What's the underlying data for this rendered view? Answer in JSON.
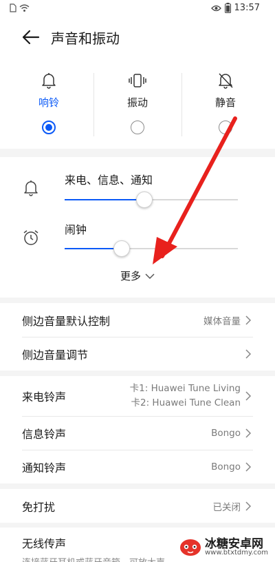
{
  "status_bar": {
    "time": "13:57"
  },
  "header": {
    "title": "声音和振动"
  },
  "modes": [
    {
      "label": "响铃",
      "icon": "bell-icon",
      "selected": true
    },
    {
      "label": "振动",
      "icon": "vibrate-icon",
      "selected": false
    },
    {
      "label": "静音",
      "icon": "bell-off-icon",
      "selected": false
    }
  ],
  "volume": {
    "sliders": [
      {
        "label": "来电、信息、通知",
        "icon": "bell-icon",
        "level": 0.46
      },
      {
        "label": "闹钟",
        "icon": "alarm-clock-icon",
        "level": 0.33
      }
    ],
    "more_label": "更多"
  },
  "groups": [
    {
      "rows": [
        {
          "title": "侧边音量默认控制",
          "value": "媒体音量"
        },
        {
          "title": "侧边音量调节",
          "value": ""
        }
      ]
    },
    {
      "rows": [
        {
          "title": "来电铃声",
          "value_line1": "卡1: Huawei Tune Living",
          "value_line2": "卡2: Huawei Tune Clean"
        },
        {
          "title": "信息铃声",
          "value": "Bongo"
        },
        {
          "title": "通知铃声",
          "value": "Bongo"
        }
      ]
    },
    {
      "rows": [
        {
          "title": "免打扰",
          "value": "已关闭"
        }
      ]
    },
    {
      "rows": [
        {
          "title": "无线传声",
          "subtitle": "连接蓝牙耳机或蓝牙音箱，可放大声"
        }
      ]
    }
  ],
  "annotation": {
    "color": "#e8211d"
  },
  "watermark": {
    "name": "冰糖安卓网",
    "url": "www.btxtdmy.com"
  },
  "colors": {
    "accent": "#0a59f7",
    "background": "#f4f4f4"
  }
}
